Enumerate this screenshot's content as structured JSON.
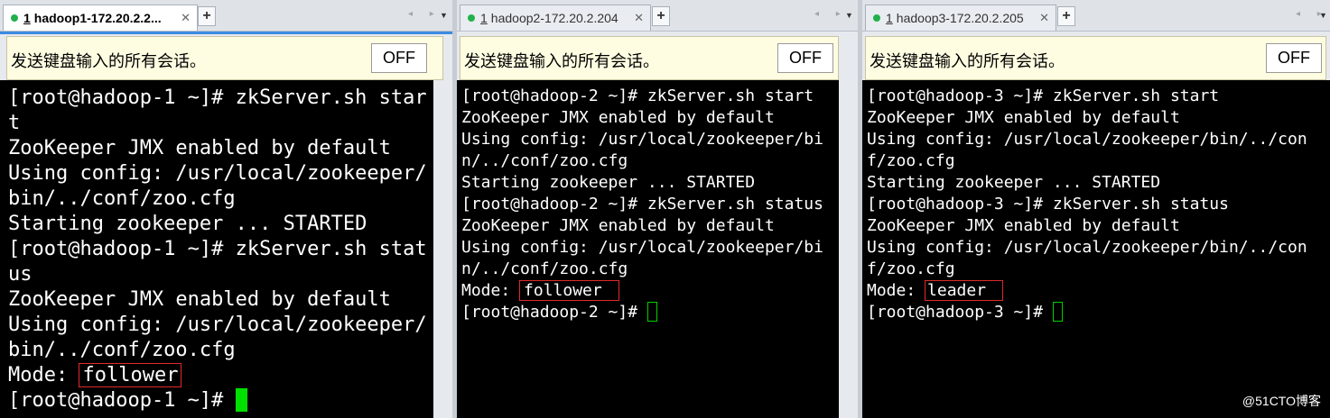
{
  "panes": [
    {
      "tab": {
        "number": "1",
        "title": "hadoop1-172.20.2.2...",
        "close": "✕"
      },
      "broadcast": {
        "text": "发送键盘输入的所有会话。",
        "toggle": "OFF"
      },
      "lines": [
        "[root@hadoop-1 ~]# zkServer.sh star",
        "t",
        "ZooKeeper JMX enabled by default",
        "Using config: /usr/local/zookeeper/",
        "bin/../conf/zoo.cfg",
        "Starting zookeeper ... STARTED",
        "[root@hadoop-1 ~]# zkServer.sh stat",
        "us",
        "ZooKeeper JMX enabled by default",
        "Using config: /usr/local/zookeeper/",
        "bin/../conf/zoo.cfg"
      ],
      "mode_label": "Mode: ",
      "mode_value": "follower",
      "prompt": "[root@hadoop-1 ~]# "
    },
    {
      "tab": {
        "number": "1",
        "title": "hadoop2-172.20.2.204",
        "close": "✕"
      },
      "broadcast": {
        "text": "发送键盘输入的所有会话。",
        "toggle": "OFF"
      },
      "lines": [
        "[root@hadoop-2 ~]# zkServer.sh start",
        "ZooKeeper JMX enabled by default",
        "Using config: /usr/local/zookeeper/bi",
        "n/../conf/zoo.cfg",
        "Starting zookeeper ... STARTED",
        "[root@hadoop-2 ~]# zkServer.sh status",
        "ZooKeeper JMX enabled by default",
        "Using config: /usr/local/zookeeper/bi",
        "n/../conf/zoo.cfg"
      ],
      "mode_label": "Mode: ",
      "mode_value": "follower",
      "prompt": "[root@hadoop-2 ~]# "
    },
    {
      "tab": {
        "number": "1",
        "title": "hadoop3-172.20.2.205",
        "close": "✕"
      },
      "broadcast": {
        "text": "发送键盘输入的所有会话。",
        "toggle": "OFF"
      },
      "lines": [
        "[root@hadoop-3 ~]# zkServer.sh start",
        "ZooKeeper JMX enabled by default",
        "Using config: /usr/local/zookeeper/bin/../con",
        "f/zoo.cfg",
        "Starting zookeeper ... STARTED",
        "[root@hadoop-3 ~]# zkServer.sh status",
        "ZooKeeper JMX enabled by default",
        "Using config: /usr/local/zookeeper/bin/../con",
        "f/zoo.cfg"
      ],
      "mode_label": "Mode: ",
      "mode_value": "leader",
      "prompt": "[root@hadoop-3 ~]# "
    }
  ],
  "tabbar": {
    "add": "+",
    "nav": "◂ ▸",
    "menu": "▼"
  },
  "watermark": "@51CTO博客",
  "colors": {
    "terminal_bg": "#000000",
    "terminal_fg": "#ffffff",
    "cursor": "#00e000",
    "highlight_box": "#e02a2a",
    "broadcast_bg": "#fffde1"
  }
}
